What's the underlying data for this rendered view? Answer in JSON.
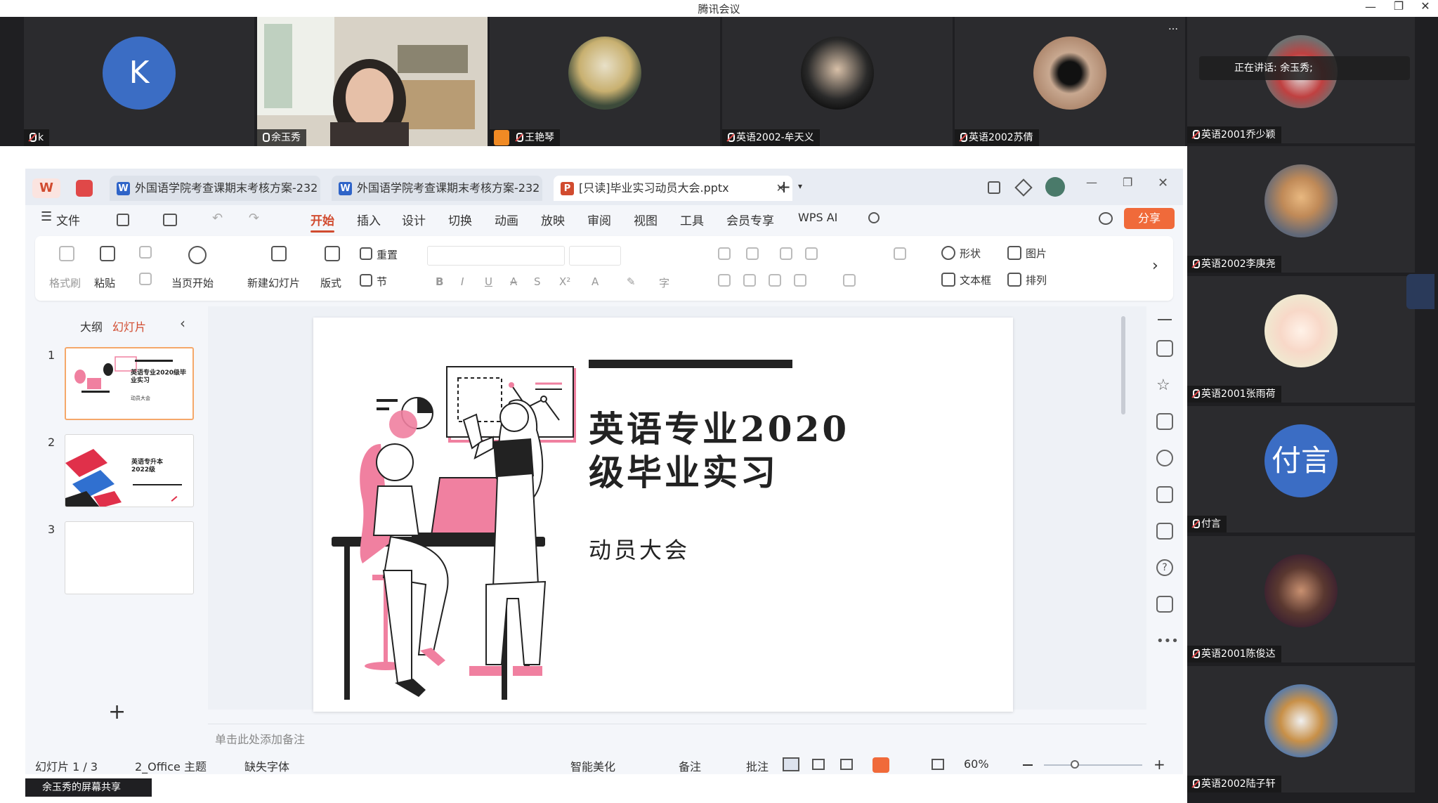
{
  "window": {
    "title": "腾讯会议"
  },
  "speaking": {
    "label": "正在讲话:",
    "name": "余玉秀;"
  },
  "participants_top": [
    {
      "name": "k",
      "initial": "K",
      "color": "#3b6dc4"
    },
    {
      "name": "余玉秀"
    },
    {
      "name": "王艳琴"
    },
    {
      "name": "英语2002-牟天义"
    },
    {
      "name": "英语2002苏倩"
    }
  ],
  "participants_right": [
    {
      "name": "英语2001乔少颖"
    },
    {
      "name": "英语2002李庚尧"
    },
    {
      "name": "英语2001张雨荷"
    },
    {
      "name": "付言",
      "initial": "付言",
      "color": "#3b6dc4"
    },
    {
      "name": "英语2001陈俊达"
    },
    {
      "name": "英语2002陆子轩"
    }
  ],
  "more_icon": "…",
  "screen_share_label": "余玉秀的屏幕共享",
  "wps": {
    "tabs": [
      {
        "label": "外国语学院考查课期末考核方案-232",
        "icon": "W",
        "color": "#2f64c8"
      },
      {
        "label": "外国语学院考查课期末考核方案-232",
        "icon": "W",
        "color": "#2f64c8"
      },
      {
        "label": "[只读]毕业实习动员大会.pptx",
        "icon": "P",
        "color": "#d14b2f"
      }
    ],
    "menu": [
      "文件",
      "开始",
      "插入",
      "设计",
      "切换",
      "动画",
      "放映",
      "审阅",
      "视图",
      "工具",
      "会员专享",
      "WPS AI"
    ],
    "share_label": "分享",
    "ribbon": {
      "format_painter": "格式刷",
      "paste": "粘贴",
      "from_current": "当页开始",
      "new_slide": "新建幻灯片",
      "layout": "版式",
      "reset": "重置",
      "section": "节",
      "shape": "形状",
      "picture": "图片",
      "textbox": "文本框",
      "arrange": "排列"
    },
    "panel_tabs": {
      "outline": "大纲",
      "slides": "幻灯片"
    },
    "slide_numbers": [
      "1",
      "2",
      "3"
    ],
    "thumb2_title": "英语专升本 2022级",
    "thumb1_title": "英语专业2020级毕业实习",
    "thumb1_sub": "动员大会",
    "add": "+",
    "notes_placeholder": "单击此处添加备注",
    "slide": {
      "title_line1": "英语专业2020",
      "title_line2": "级毕业实习",
      "subtitle": "动员大会"
    },
    "status": {
      "slide_count": "幻灯片 1 / 3",
      "theme": "2_Office 主题",
      "missing_font": "缺失字体",
      "beautify": "智能美化",
      "notes": "备注",
      "comment": "批注",
      "zoom": "60%"
    }
  }
}
